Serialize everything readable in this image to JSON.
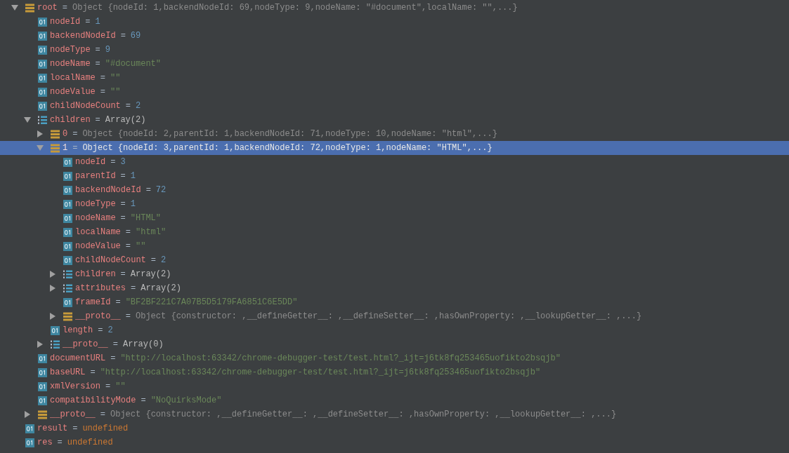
{
  "variables": [
    {
      "name": "root",
      "kind": "object",
      "equals": "=",
      "value": {
        "kind": "object",
        "text": "Object {nodeId: 1,backendNodeId: 69,nodeType: 9,nodeName: \"#document\",localName: \"\",...}"
      },
      "expanded": true,
      "selected": false,
      "children": [
        {
          "name": "nodeId",
          "kind": "primitive",
          "equals": "=",
          "value": {
            "kind": "number",
            "text": "1"
          },
          "selected": false
        },
        {
          "name": "backendNodeId",
          "kind": "primitive",
          "equals": "=",
          "value": {
            "kind": "number",
            "text": "69"
          },
          "selected": false
        },
        {
          "name": "nodeType",
          "kind": "primitive",
          "equals": "=",
          "value": {
            "kind": "number",
            "text": "9"
          },
          "selected": false
        },
        {
          "name": "nodeName",
          "kind": "primitive",
          "equals": "=",
          "value": {
            "kind": "string",
            "text": "\"#document\""
          },
          "selected": false
        },
        {
          "name": "localName",
          "kind": "primitive",
          "equals": "=",
          "value": {
            "kind": "string",
            "text": "\"\""
          },
          "selected": false
        },
        {
          "name": "nodeValue",
          "kind": "primitive",
          "equals": "=",
          "value": {
            "kind": "string",
            "text": "\"\""
          },
          "selected": false
        },
        {
          "name": "childNodeCount",
          "kind": "primitive",
          "equals": "=",
          "value": {
            "kind": "number",
            "text": "2"
          },
          "selected": false
        },
        {
          "name": "children",
          "kind": "array",
          "equals": "=",
          "value": {
            "kind": "plain",
            "text": "Array(2)"
          },
          "expanded": true,
          "selected": false,
          "children": [
            {
              "name": "0",
              "kind": "object",
              "equals": "=",
              "value": {
                "kind": "object",
                "text": "Object {nodeId: 2,parentId: 1,backendNodeId: 71,nodeType: 10,nodeName: \"html\",...}"
              },
              "expanded": false,
              "selected": false
            },
            {
              "name": "1",
              "kind": "object",
              "equals": "=",
              "value": {
                "kind": "object",
                "text": "Object {nodeId: 3,parentId: 1,backendNodeId: 72,nodeType: 1,nodeName: \"HTML\",...}"
              },
              "expanded": true,
              "selected": true,
              "children": [
                {
                  "name": "nodeId",
                  "kind": "primitive",
                  "equals": "=",
                  "value": {
                    "kind": "number",
                    "text": "3"
                  },
                  "selected": false
                },
                {
                  "name": "parentId",
                  "kind": "primitive",
                  "equals": "=",
                  "value": {
                    "kind": "number",
                    "text": "1"
                  },
                  "selected": false
                },
                {
                  "name": "backendNodeId",
                  "kind": "primitive",
                  "equals": "=",
                  "value": {
                    "kind": "number",
                    "text": "72"
                  },
                  "selected": false
                },
                {
                  "name": "nodeType",
                  "kind": "primitive",
                  "equals": "=",
                  "value": {
                    "kind": "number",
                    "text": "1"
                  },
                  "selected": false
                },
                {
                  "name": "nodeName",
                  "kind": "primitive",
                  "equals": "=",
                  "value": {
                    "kind": "string",
                    "text": "\"HTML\""
                  },
                  "selected": false
                },
                {
                  "name": "localName",
                  "kind": "primitive",
                  "equals": "=",
                  "value": {
                    "kind": "string",
                    "text": "\"html\""
                  },
                  "selected": false
                },
                {
                  "name": "nodeValue",
                  "kind": "primitive",
                  "equals": "=",
                  "value": {
                    "kind": "string",
                    "text": "\"\""
                  },
                  "selected": false
                },
                {
                  "name": "childNodeCount",
                  "kind": "primitive",
                  "equals": "=",
                  "value": {
                    "kind": "number",
                    "text": "2"
                  },
                  "selected": false
                },
                {
                  "name": "children",
                  "kind": "array",
                  "equals": "=",
                  "value": {
                    "kind": "plain",
                    "text": "Array(2)"
                  },
                  "expanded": false,
                  "selected": false
                },
                {
                  "name": "attributes",
                  "kind": "array",
                  "equals": "=",
                  "value": {
                    "kind": "plain",
                    "text": "Array(2)"
                  },
                  "expanded": false,
                  "selected": false
                },
                {
                  "name": "frameId",
                  "kind": "primitive",
                  "equals": "=",
                  "value": {
                    "kind": "string",
                    "text": "\"BF2BF221C7A07B5D5179FA6851C6E5DD\""
                  },
                  "selected": false
                },
                {
                  "name": "__proto__",
                  "kind": "object",
                  "equals": "=",
                  "value": {
                    "kind": "object",
                    "text": "Object {constructor: ,__defineGetter__: ,__defineSetter__: ,hasOwnProperty: ,__lookupGetter__: ,...}"
                  },
                  "expanded": false,
                  "selected": false
                }
              ]
            },
            {
              "name": "length",
              "kind": "primitive",
              "equals": "=",
              "value": {
                "kind": "number",
                "text": "2"
              },
              "selected": false
            },
            {
              "name": "__proto__",
              "kind": "array",
              "equals": "=",
              "value": {
                "kind": "plain",
                "text": "Array(0)"
              },
              "expanded": false,
              "selected": false
            }
          ]
        },
        {
          "name": "documentURL",
          "kind": "primitive",
          "equals": "=",
          "value": {
            "kind": "string",
            "text": "\"http://localhost:63342/chrome-debugger-test/test.html?_ijt=j6tk8fq253465uofikto2bsqjb\""
          },
          "selected": false
        },
        {
          "name": "baseURL",
          "kind": "primitive",
          "equals": "=",
          "value": {
            "kind": "string",
            "text": "\"http://localhost:63342/chrome-debugger-test/test.html?_ijt=j6tk8fq253465uofikto2bsqjb\""
          },
          "selected": false
        },
        {
          "name": "xmlVersion",
          "kind": "primitive",
          "equals": "=",
          "value": {
            "kind": "string",
            "text": "\"\""
          },
          "selected": false
        },
        {
          "name": "compatibilityMode",
          "kind": "primitive",
          "equals": "=",
          "value": {
            "kind": "string",
            "text": "\"NoQuirksMode\""
          },
          "selected": false
        },
        {
          "name": "__proto__",
          "kind": "object",
          "equals": "=",
          "value": {
            "kind": "object",
            "text": "Object {constructor: ,__defineGetter__: ,__defineSetter__: ,hasOwnProperty: ,__lookupGetter__: ,...}"
          },
          "expanded": false,
          "selected": false
        }
      ]
    },
    {
      "name": "result",
      "kind": "primitive",
      "equals": "=",
      "value": {
        "kind": "undefined",
        "text": "undefined"
      },
      "selected": false
    },
    {
      "name": "res",
      "kind": "primitive",
      "equals": "=",
      "value": {
        "kind": "undefined",
        "text": "undefined"
      },
      "selected": false
    }
  ]
}
